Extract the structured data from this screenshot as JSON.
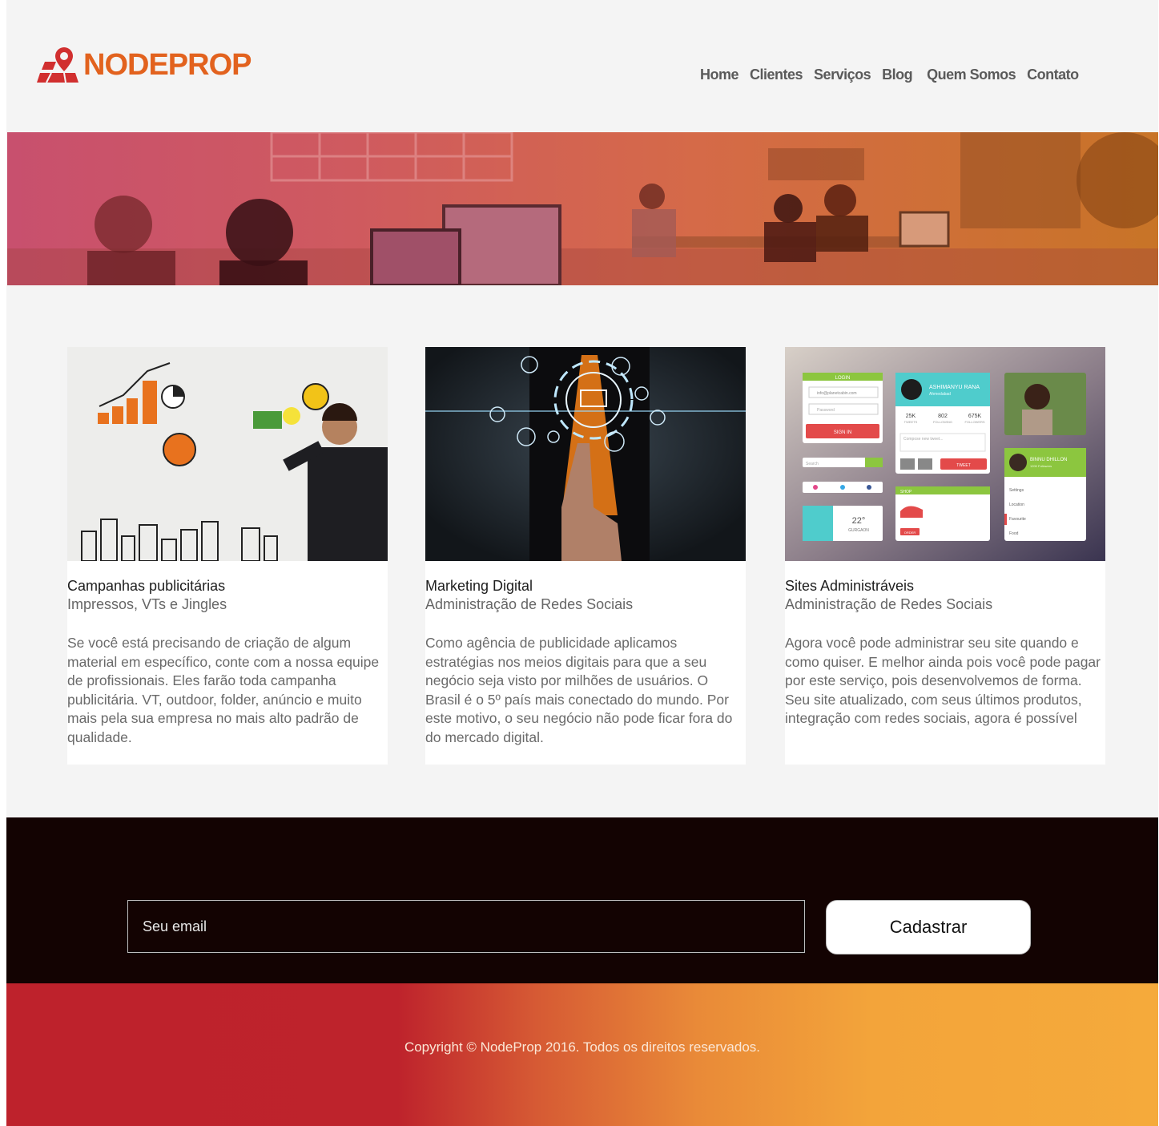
{
  "brand": {
    "name": "NODEPROP",
    "color": "#e2621e",
    "accent": "#d12f2f",
    "icon": "map-pin-icon"
  },
  "nav": [
    {
      "label": "Home"
    },
    {
      "label": "Clientes"
    },
    {
      "label": "Serviços"
    },
    {
      "label": "Blog"
    },
    {
      "label": "Quem Somos"
    },
    {
      "label": "Contato"
    }
  ],
  "hero": {
    "image": "office-team-photo",
    "overlay": [
      "#c8506e",
      "#c87427"
    ]
  },
  "cards": [
    {
      "image": "business-strategy-whiteboard",
      "title": "Campanhas publicitárias",
      "subtitle": "Impressos, VTs e Jingles",
      "body": "Se você está precisando de criação de algum material em específico, conte com a nossa equipe de profissionais. Eles farão toda campanha publicitária. VT, outdoor, folder, anúncio e muito mais pela sua empresa no mais alto padrão de qualidade."
    },
    {
      "image": "digital-marketing-touch",
      "title": "Marketing Digital",
      "subtitle": "Administração de Redes Sociais",
      "body": "Como agência de publicidade aplicamos estratégias nos meios digitais para que a seu negócio seja visto por milhões de usuários. O Brasil é o 5º país mais conectado do mundo. Por este motivo, o seu negócio não pode ficar fora do do mercado digital."
    },
    {
      "image": "admin-ui-kit",
      "title": "Sites Administráveis",
      "subtitle": "Administração de Redes Sociais",
      "body": "Agora você pode administrar seu site quando e como quiser. E melhor ainda pois você pode pagar por este serviço, pois desenvolvemos de forma. Seu site atualizado, com seus últimos produtos, integração com redes sociais, agora é possível"
    }
  ],
  "ui_kit": {
    "login_header": "LOGIN",
    "email_value": "info@planetcabin.com",
    "password_placeholder": "Password",
    "signin_label": "SIGN IN",
    "profile_name": "ASHIMANYU RANA",
    "profile_location": "Ahmedabad",
    "stats": [
      {
        "value": "25K",
        "label": "TWEETS"
      },
      {
        "value": "802",
        "label": "FOLLOWING"
      },
      {
        "value": "675K",
        "label": "FOLLOWERS"
      }
    ],
    "compose_placeholder": "Compose new tweet...",
    "tweet_label": "TWEET",
    "search_placeholder": "Search",
    "weather_temp": "22°",
    "weather_city": "GURGAON",
    "shop_header": "SHOP",
    "order_label": "ORDER",
    "user2_name": "BINNU DHILLON",
    "user2_sub": "1200 Followers",
    "menu": [
      "Settings",
      "Location",
      "Favourite",
      "Food"
    ]
  },
  "newsletter": {
    "email_placeholder": "Seu email",
    "submit_label": "Cadastrar",
    "background": "#130302"
  },
  "footer": {
    "copyright": "Copyright © NodeProp 2016. Todos os direitos reservados.",
    "gradient": [
      "#be222c",
      "#f5aa3b"
    ]
  }
}
